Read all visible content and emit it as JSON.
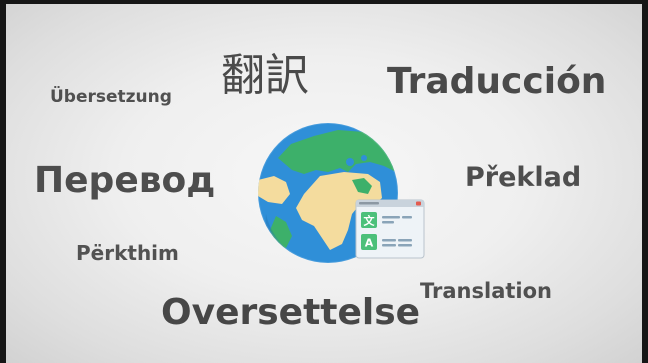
{
  "words": {
    "ubersetzung": "Übersetzung",
    "honyaku": "翻訳",
    "traduccion": "Traducción",
    "perevod": "Перевод",
    "preklad": "Překlad",
    "perkthim": "Përkthim",
    "translation": "Translation",
    "oversettelse": "Oversettelse"
  },
  "translator_card": {
    "source_glyph": "文",
    "target_glyph": "A"
  },
  "colors": {
    "text": "#4a4a4a",
    "ocean": "#2f8fd8",
    "land": "#f4dc9e",
    "forest": "#3db06a",
    "card_accent": "#4cc07a"
  }
}
